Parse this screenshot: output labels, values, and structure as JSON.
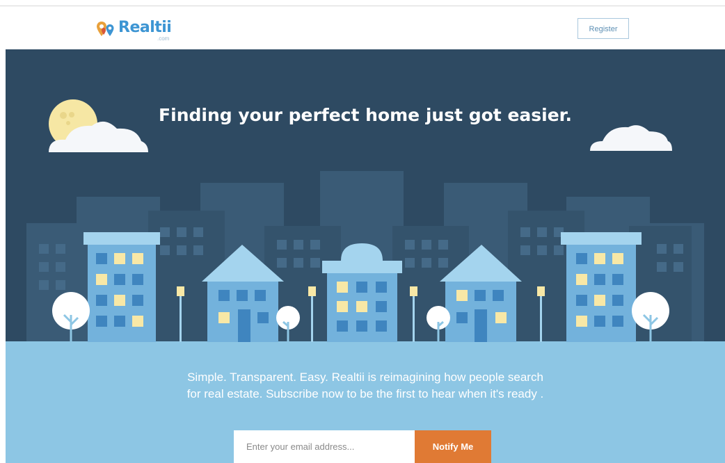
{
  "header": {
    "logo_text": "Realtii",
    "logo_subtext": ".com",
    "register_label": "Register"
  },
  "hero": {
    "headline": "Finding your perfect home just got easier.",
    "tagline_line1": "Simple. Transparent. Easy. Realtii is reimagining how people search",
    "tagline_line2": "for real estate. Subscribe now to be the first to hear when it's ready ."
  },
  "subscribe": {
    "email_placeholder": "Enter your email address...",
    "email_value": "",
    "notify_label": "Notify Me"
  },
  "colors": {
    "sky": "#2e4a62",
    "ground": "#8dc6e4",
    "accent_orange": "#e07a34",
    "brand_blue": "#3d95d3",
    "window_lit": "#f8e8a6",
    "moon": "#f6e7a4"
  },
  "icons": {
    "logo": "map-pins-icon",
    "moon": "moon-icon",
    "cloud": "cloud-icon",
    "tree": "tree-icon",
    "lamp": "street-lamp-icon"
  }
}
